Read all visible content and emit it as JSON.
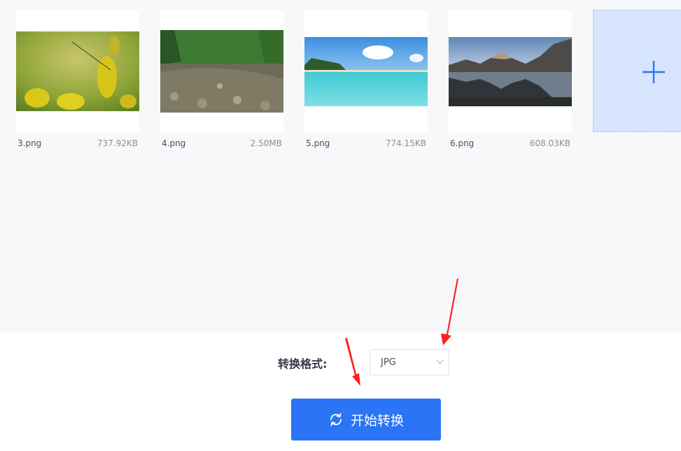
{
  "files": [
    {
      "name": "3.png",
      "size": "737.92KB"
    },
    {
      "name": "4.png",
      "size": "2.50MB"
    },
    {
      "name": "5.png",
      "size": "774.15KB"
    },
    {
      "name": "6.png",
      "size": "608.03KB"
    }
  ],
  "add_icon": "plus-icon",
  "format": {
    "label": "转换格式:",
    "selected": "JPG"
  },
  "start_button": {
    "label": "开始转换",
    "icon": "refresh-icon"
  },
  "colors": {
    "primary": "#2b74f6",
    "add_tile_bg": "#d6e4fd",
    "annotation_arrow": "#ff1f1f"
  }
}
